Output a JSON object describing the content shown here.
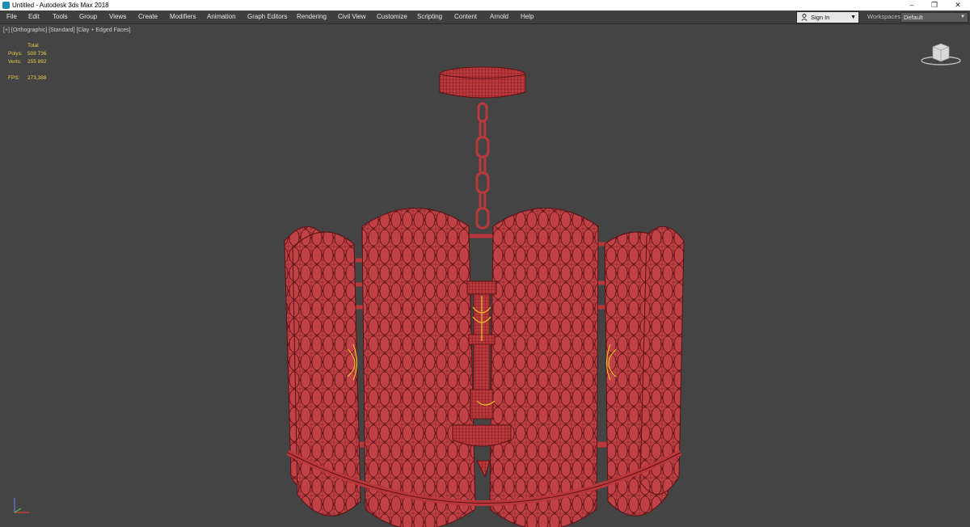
{
  "window": {
    "title": "Untitled - Autodesk 3ds Max 2018",
    "minimize": "–",
    "restore": "❐",
    "close": "✕"
  },
  "menu": [
    "File",
    "Edit",
    "Tools",
    "Group",
    "Views",
    "Create",
    "Modifiers",
    "Animation",
    "Graph Editors",
    "Rendering",
    "Civil View",
    "Customize",
    "Scripting",
    "Content",
    "Arnold",
    "Help"
  ],
  "account": {
    "sign_in": "Sign In",
    "workspaces_label": "Workspaces:",
    "workspace_value": "Default"
  },
  "viewport": {
    "labels": "[+] [Orthographic] [Standard] [Clay + Edged Faces]",
    "stats": {
      "header": "Total",
      "polys_label": "Polys:",
      "polys_value": "508 736",
      "verts_label": "Verts:",
      "verts_value": "255 892",
      "fps_label": "FPS:",
      "fps_value": "273,388"
    }
  },
  "colors": {
    "model": "#b9383c",
    "wire": "#5e1214",
    "stats": "#e2cf4b",
    "viewport_bg": "#444444",
    "menubar": "#3f3f3f"
  }
}
